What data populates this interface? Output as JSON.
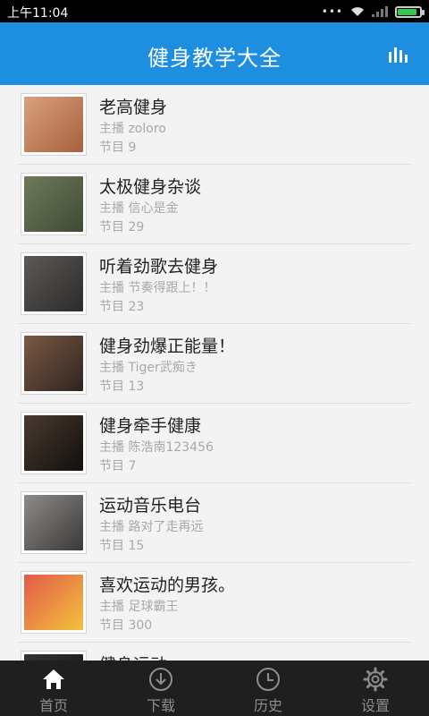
{
  "status_bar": {
    "time": "上午11:04",
    "battery_level": 0.9
  },
  "header": {
    "title": "健身教学大全",
    "stats_icon": "bar-chart-icon"
  },
  "list": {
    "items": [
      {
        "title": "老高健身",
        "host": "主播 zoloro",
        "count": "节目 9",
        "thumb_colors": [
          "#d9a27f",
          "#a85f3c"
        ]
      },
      {
        "title": "太极健身杂谈",
        "host": "主播 信心是金",
        "count": "节目 29",
        "thumb_colors": [
          "#6f7a5a",
          "#3f4a36"
        ]
      },
      {
        "title": "听着劲歌去健身",
        "host": "主播 节奏得跟上！！",
        "count": "节目 23",
        "thumb_colors": [
          "#5c5a58",
          "#2c2b2a"
        ]
      },
      {
        "title": "健身劲爆正能量！",
        "host": "主播 Tiger武痴き",
        "count": "节目 13",
        "thumb_colors": [
          "#7a5a44",
          "#2f2420"
        ]
      },
      {
        "title": "健身牵手健康",
        "host": "主播 陈浩南123456",
        "count": "节目 7",
        "thumb_colors": [
          "#4a3a30",
          "#120f0d"
        ]
      },
      {
        "title": "运动音乐电台",
        "host": "主播 路对了走再远",
        "count": "节目 15",
        "thumb_colors": [
          "#8e8c8a",
          "#3a3938"
        ]
      },
      {
        "title": "喜欢运动的男孩。",
        "host": "主播 足球霸王",
        "count": "节目 300",
        "thumb_colors": [
          "#e35a4a",
          "#f2c23c"
        ]
      },
      {
        "title": "健身运动",
        "host": "",
        "count": "",
        "thumb_colors": [
          "#333333",
          "#111111"
        ]
      }
    ]
  },
  "tabs": [
    {
      "label": "首页",
      "icon": "home-icon",
      "active": true
    },
    {
      "label": "下载",
      "icon": "download-icon",
      "active": false
    },
    {
      "label": "历史",
      "icon": "history-clock-icon",
      "active": false
    },
    {
      "label": "设置",
      "icon": "settings-gear-icon",
      "active": false
    }
  ]
}
